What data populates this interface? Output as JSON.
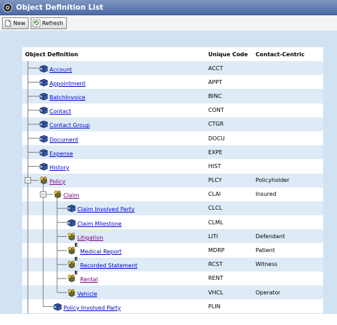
{
  "window": {
    "title": "Object Definition List",
    "icon": "gear-globe-icon"
  },
  "toolbar": {
    "new_label": "New",
    "refresh_label": "Refresh"
  },
  "table": {
    "headers": {
      "object_definition": "Object Definition",
      "unique_code": "Unique Code",
      "contact_centric": "Contact-Centric"
    },
    "rows": [
      {
        "name": "Account",
        "code": "ACCT",
        "contact": "",
        "level": 0,
        "icon": "object-icon",
        "link_color": "#0000cc"
      },
      {
        "name": "Appointment",
        "code": "APPT",
        "contact": "",
        "level": 0,
        "icon": "object-icon",
        "link_color": "#0000cc"
      },
      {
        "name": "BatchInvoice",
        "code": "BINC",
        "contact": "",
        "level": 0,
        "icon": "object-icon",
        "link_color": "#0000cc"
      },
      {
        "name": "Contact",
        "code": "CONT",
        "contact": "",
        "level": 0,
        "icon": "object-icon",
        "link_color": "#0000cc"
      },
      {
        "name": "Contact Group",
        "code": "CTGR",
        "contact": "",
        "level": 0,
        "icon": "object-icon",
        "link_color": "#0000cc"
      },
      {
        "name": "Document",
        "code": "DOCU",
        "contact": "",
        "level": 0,
        "icon": "object-icon",
        "link_color": "#0000cc"
      },
      {
        "name": "Expense",
        "code": "EXPE",
        "contact": "",
        "level": 0,
        "icon": "object-icon",
        "link_color": "#0000cc"
      },
      {
        "name": "History",
        "code": "HIST",
        "contact": "",
        "level": 0,
        "icon": "object-icon",
        "link_color": "#0000cc"
      },
      {
        "name": "Policy",
        "code": "PLCY",
        "contact": "Policyholder",
        "level": 0,
        "icon": "contact-object-icon",
        "link_color": "#800080",
        "expanded": true
      },
      {
        "name": "Claim",
        "code": "CLAI",
        "contact": "Insured",
        "level": 1,
        "icon": "contact-object-icon",
        "link_color": "#800080",
        "expanded": true
      },
      {
        "name": "Claim Involved Party",
        "code": "CLCL",
        "contact": "",
        "level": 2,
        "icon": "object-icon",
        "link_color": "#0000cc"
      },
      {
        "name": "Claim Milestone",
        "code": "CLML",
        "contact": "",
        "level": 2,
        "icon": "object-icon",
        "link_color": "#0000cc"
      },
      {
        "name": "Litigation",
        "code": "LITI",
        "contact": "Defendant",
        "level": 2,
        "icon": "contact-object-icon",
        "link_color": "#800080"
      },
      {
        "name": "Medical Report",
        "code": "MDRP",
        "contact": "Patient",
        "level": 2,
        "icon": "contact-entity-object-icon",
        "link_color": "#0000cc",
        "badge": "E"
      },
      {
        "name": "Recorded Statement",
        "code": "RCST",
        "contact": "Witness",
        "level": 2,
        "icon": "contact-entity-object-icon",
        "link_color": "#0000cc",
        "badge": "E"
      },
      {
        "name": "Rental",
        "code": "RENT",
        "contact": "",
        "level": 2,
        "icon": "contact-entity-object-icon",
        "link_color": "#800080",
        "badge": "E"
      },
      {
        "name": "Vehicle",
        "code": "VHCL",
        "contact": "Operator",
        "level": 2,
        "icon": "contact-object-icon",
        "link_color": "#0000cc"
      },
      {
        "name": "Policy Involved Party",
        "code": "PLIN",
        "contact": "",
        "level": 1,
        "icon": "object-icon",
        "link_color": "#0000cc"
      }
    ]
  }
}
